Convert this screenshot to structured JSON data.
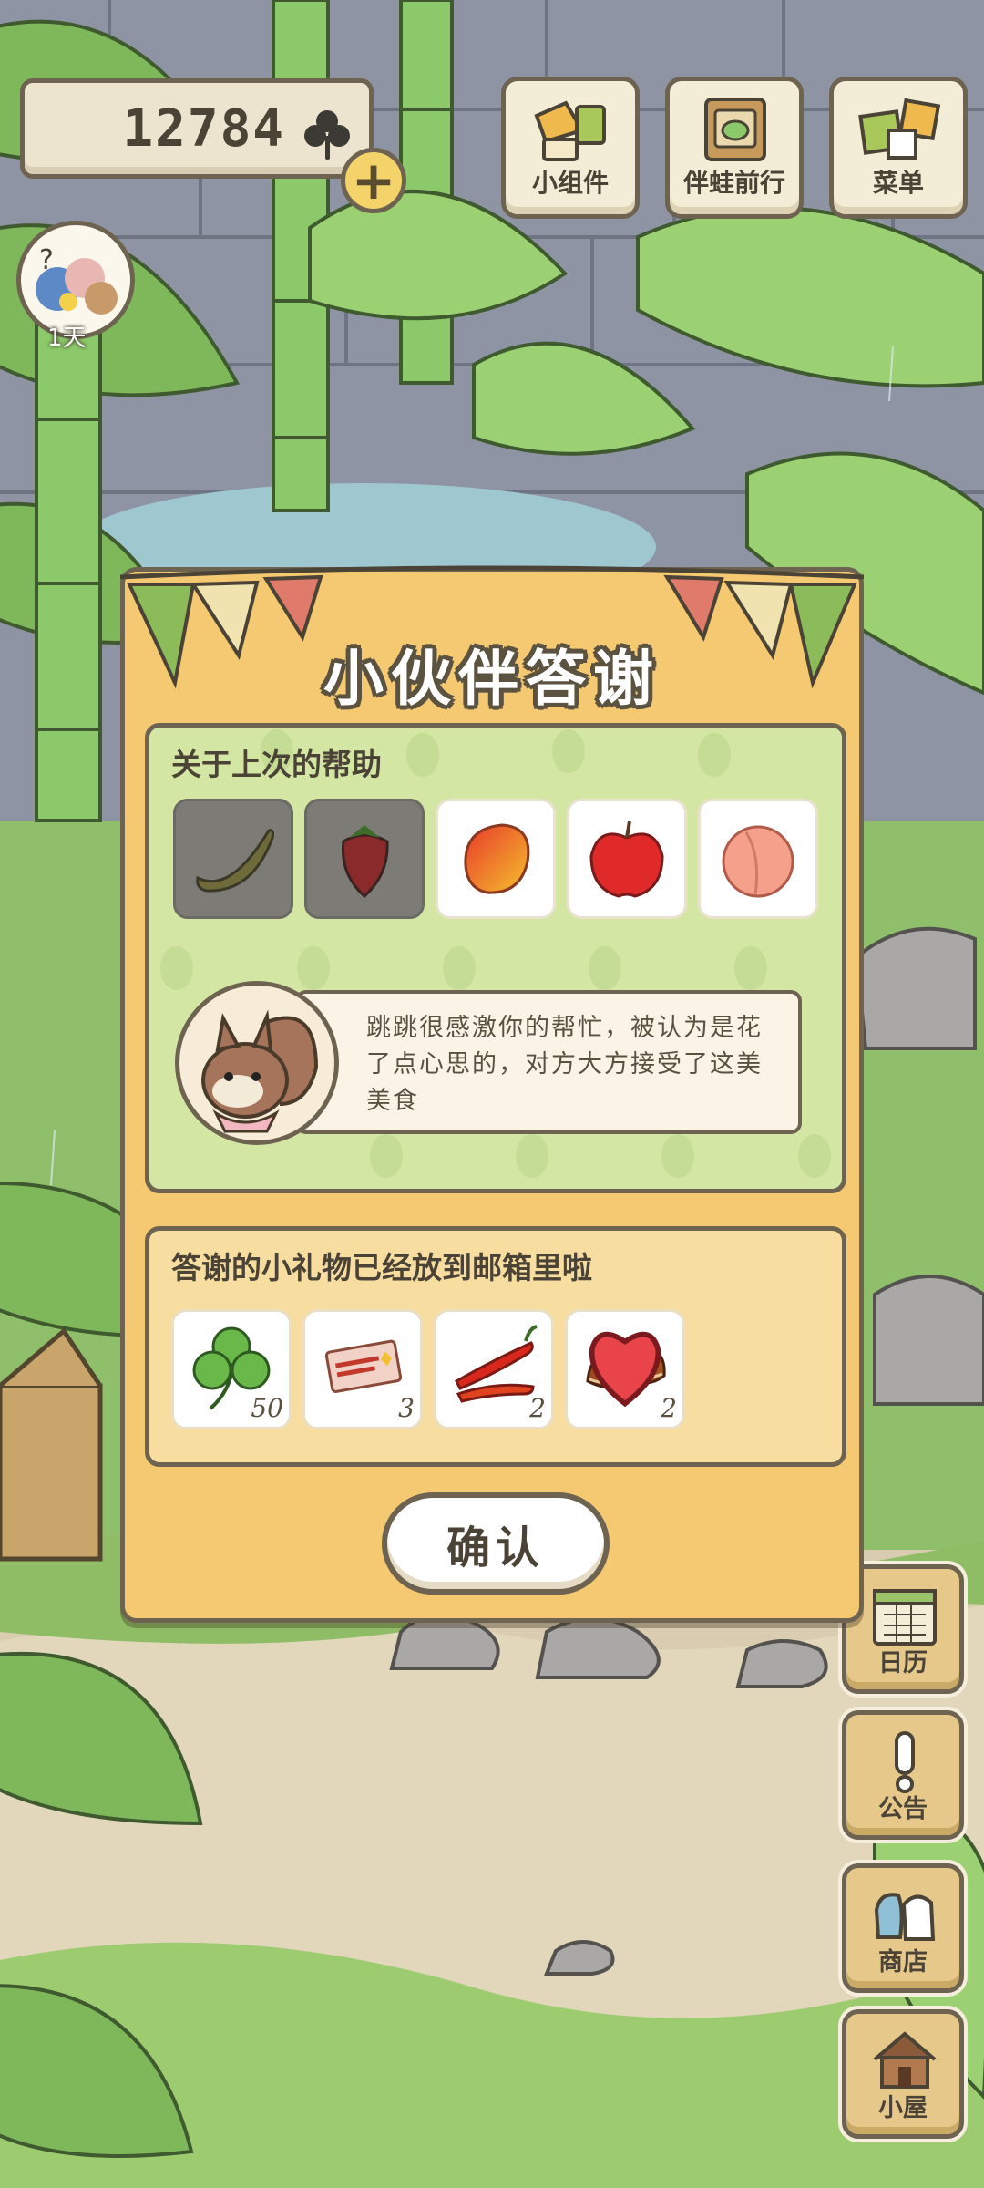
{
  "hud": {
    "currency_value": "12784",
    "currency_icon": "clover-icon",
    "add_label": "+",
    "avatar_label": "1天"
  },
  "top_menu": [
    {
      "label": "小组件",
      "icon": "widget-icon"
    },
    {
      "label": "伴蛙前行",
      "icon": "frog-journey-icon"
    },
    {
      "label": "菜单",
      "icon": "menu-icon"
    }
  ],
  "side_menu": [
    {
      "label": "日历",
      "icon": "calendar-icon"
    },
    {
      "label": "公告",
      "icon": "notice-icon"
    },
    {
      "label": "商店",
      "icon": "shop-icon"
    },
    {
      "label": "小屋",
      "icon": "house-icon"
    }
  ],
  "dialog": {
    "title": "小伙伴答谢",
    "help_heading": "关于上次的帮助",
    "help_items": [
      {
        "icon": "banana-icon",
        "dimmed": true
      },
      {
        "icon": "strawberry-icon",
        "dimmed": true
      },
      {
        "icon": "mango-icon",
        "dimmed": false
      },
      {
        "icon": "apple-icon",
        "dimmed": false
      },
      {
        "icon": "peach-icon",
        "dimmed": false
      }
    ],
    "friend_icon": "squirrel-icon",
    "message": "跳跳很感激你的帮忙，被认为是花了点心思的，对方大方接受了这美美食",
    "gift_heading": "答谢的小礼物已经放到邮箱里啦",
    "gifts": [
      {
        "icon": "clover-icon",
        "count": "50"
      },
      {
        "icon": "ticket-icon",
        "count": "3"
      },
      {
        "icon": "chili-icon",
        "count": "2"
      },
      {
        "icon": "chestnut-icon",
        "count": "2",
        "badge": "heart-icon"
      }
    ],
    "confirm_label": "确认"
  },
  "colors": {
    "dialog_bg": "#f5c872",
    "help_bg": "#d4e6a4",
    "gift_bg": "#f8dda0",
    "outline": "#6d6350"
  }
}
